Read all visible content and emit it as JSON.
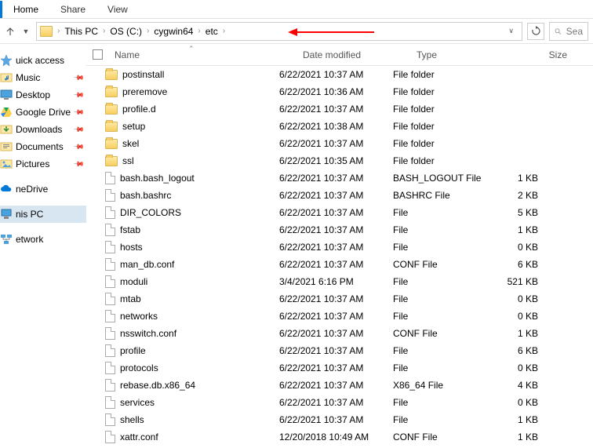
{
  "ribbon": {
    "tabs": [
      "Home",
      "Share",
      "View"
    ],
    "active": 0
  },
  "breadcrumb": [
    "This PC",
    "OS (C:)",
    "cygwin64",
    "etc"
  ],
  "search_placeholder": "Sea",
  "nav": [
    {
      "label": "uick access",
      "icon": "star"
    },
    {
      "label": "Music",
      "icon": "music",
      "pinned": true
    },
    {
      "label": "Desktop",
      "icon": "desktop",
      "pinned": true
    },
    {
      "label": "Google Drive",
      "icon": "gdrive",
      "pinned": true
    },
    {
      "label": "Downloads",
      "icon": "download",
      "pinned": true
    },
    {
      "label": "Documents",
      "icon": "doc",
      "pinned": true
    },
    {
      "label": "Pictures",
      "icon": "pic",
      "pinned": true
    },
    {
      "label": "neDrive",
      "icon": "cloud",
      "spacer": true
    },
    {
      "label": "nis PC",
      "icon": "pc",
      "selected": true,
      "spacer": true
    },
    {
      "label": "etwork",
      "icon": "net",
      "spacer": true
    }
  ],
  "columns": {
    "name": "Name",
    "date": "Date modified",
    "type": "Type",
    "size": "Size"
  },
  "files": [
    {
      "name": "postinstall",
      "date": "6/22/2021 10:37 AM",
      "type": "File folder",
      "size": "",
      "folder": true
    },
    {
      "name": "preremove",
      "date": "6/22/2021 10:36 AM",
      "type": "File folder",
      "size": "",
      "folder": true
    },
    {
      "name": "profile.d",
      "date": "6/22/2021 10:37 AM",
      "type": "File folder",
      "size": "",
      "folder": true
    },
    {
      "name": "setup",
      "date": "6/22/2021 10:38 AM",
      "type": "File folder",
      "size": "",
      "folder": true
    },
    {
      "name": "skel",
      "date": "6/22/2021 10:37 AM",
      "type": "File folder",
      "size": "",
      "folder": true
    },
    {
      "name": "ssl",
      "date": "6/22/2021 10:35 AM",
      "type": "File folder",
      "size": "",
      "folder": true
    },
    {
      "name": "bash.bash_logout",
      "date": "6/22/2021 10:37 AM",
      "type": "BASH_LOGOUT File",
      "size": "1 KB",
      "folder": false
    },
    {
      "name": "bash.bashrc",
      "date": "6/22/2021 10:37 AM",
      "type": "BASHRC File",
      "size": "2 KB",
      "folder": false
    },
    {
      "name": "DIR_COLORS",
      "date": "6/22/2021 10:37 AM",
      "type": "File",
      "size": "5 KB",
      "folder": false
    },
    {
      "name": "fstab",
      "date": "6/22/2021 10:37 AM",
      "type": "File",
      "size": "1 KB",
      "folder": false
    },
    {
      "name": "hosts",
      "date": "6/22/2021 10:37 AM",
      "type": "File",
      "size": "0 KB",
      "folder": false
    },
    {
      "name": "man_db.conf",
      "date": "6/22/2021 10:37 AM",
      "type": "CONF File",
      "size": "6 KB",
      "folder": false
    },
    {
      "name": "moduli",
      "date": "3/4/2021 6:16 PM",
      "type": "File",
      "size": "521 KB",
      "folder": false
    },
    {
      "name": "mtab",
      "date": "6/22/2021 10:37 AM",
      "type": "File",
      "size": "0 KB",
      "folder": false
    },
    {
      "name": "networks",
      "date": "6/22/2021 10:37 AM",
      "type": "File",
      "size": "0 KB",
      "folder": false
    },
    {
      "name": "nsswitch.conf",
      "date": "6/22/2021 10:37 AM",
      "type": "CONF File",
      "size": "1 KB",
      "folder": false
    },
    {
      "name": "profile",
      "date": "6/22/2021 10:37 AM",
      "type": "File",
      "size": "6 KB",
      "folder": false
    },
    {
      "name": "protocols",
      "date": "6/22/2021 10:37 AM",
      "type": "File",
      "size": "0 KB",
      "folder": false
    },
    {
      "name": "rebase.db.x86_64",
      "date": "6/22/2021 10:37 AM",
      "type": "X86_64 File",
      "size": "4 KB",
      "folder": false
    },
    {
      "name": "services",
      "date": "6/22/2021 10:37 AM",
      "type": "File",
      "size": "0 KB",
      "folder": false
    },
    {
      "name": "shells",
      "date": "6/22/2021 10:37 AM",
      "type": "File",
      "size": "1 KB",
      "folder": false
    },
    {
      "name": "xattr.conf",
      "date": "12/20/2018 10:49 AM",
      "type": "CONF File",
      "size": "1 KB",
      "folder": false
    }
  ]
}
